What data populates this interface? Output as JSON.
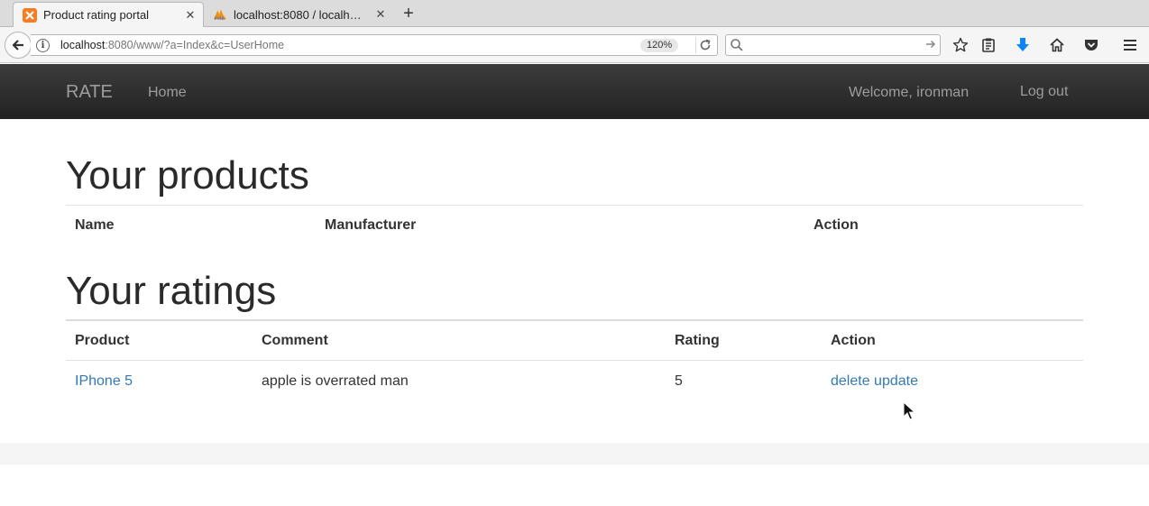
{
  "browser": {
    "tabs": [
      {
        "title": "Product rating portal",
        "active": true,
        "favicon": "xampp-icon"
      },
      {
        "title": "localhost:8080 / localh…",
        "active": false,
        "favicon": "phpmyadmin-icon"
      }
    ],
    "url_host": "localhost",
    "url_rest": ":8080/www/?a=Index&c=UserHome",
    "zoom": "120%",
    "search_placeholder": ""
  },
  "navbar": {
    "brand": "RATE",
    "home": "Home",
    "welcome": "Welcome, ironman",
    "logout": "Log out"
  },
  "products": {
    "heading": "Your products",
    "columns": [
      "Name",
      "Manufacturer",
      "Action"
    ],
    "rows": []
  },
  "ratings": {
    "heading": "Your ratings",
    "columns": [
      "Product",
      "Comment",
      "Rating",
      "Action"
    ],
    "rows": [
      {
        "product": "IPhone 5",
        "comment": "apple is overrated man",
        "rating": "5",
        "delete": "delete",
        "update": "update"
      }
    ]
  },
  "colors": {
    "link": "#337ab7",
    "navbar": "#222222",
    "nav_text": "#9d9d9d"
  }
}
